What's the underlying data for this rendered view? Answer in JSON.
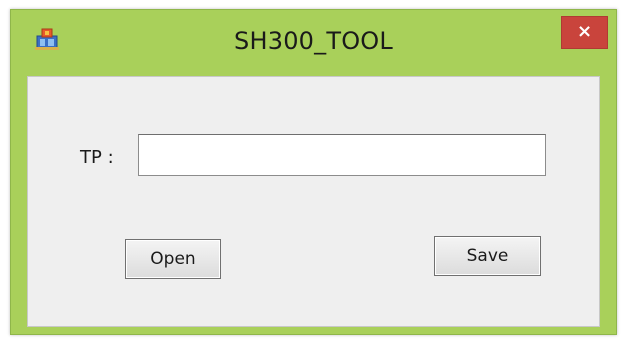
{
  "window": {
    "title": "SH300_TOOL",
    "close_label": "×",
    "title_bar_color": "#a9d05a",
    "close_button_color": "#c9443c",
    "icon": "app-icon"
  },
  "form": {
    "tp_label": "TP :",
    "tp_value": "",
    "open_label": "Open",
    "save_label": "Save"
  }
}
